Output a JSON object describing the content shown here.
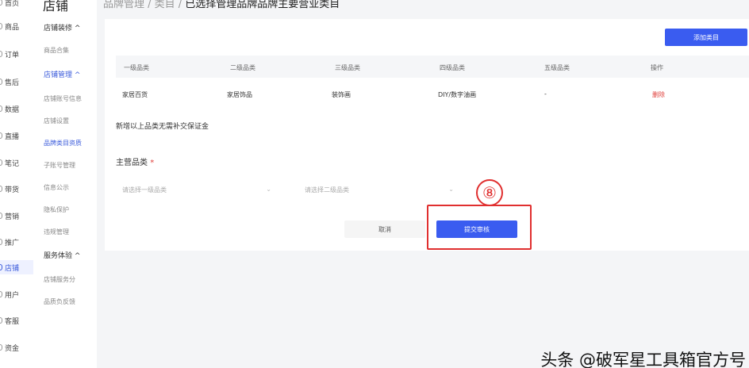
{
  "rail": {
    "items": [
      {
        "label": "首页"
      },
      {
        "label": "商品"
      },
      {
        "label": "订单"
      },
      {
        "label": "售后"
      },
      {
        "label": "数据"
      },
      {
        "label": "直播"
      },
      {
        "label": "笔记"
      },
      {
        "label": "带货"
      },
      {
        "label": "营销"
      },
      {
        "label": "推广"
      },
      {
        "label": "店铺"
      },
      {
        "label": "用户"
      },
      {
        "label": "客服"
      },
      {
        "label": "资金"
      }
    ]
  },
  "sidebar": {
    "title": "店铺",
    "groups": [
      {
        "label": "店铺装修 ^",
        "links": [
          "商品合集"
        ]
      },
      {
        "label": "店铺管理 ^",
        "links": [
          "店铺账号信息",
          "店铺设置",
          "品牌类目资质",
          "子账号管理",
          "信息公示",
          "隐私保护",
          "违规管理"
        ]
      },
      {
        "label": "服务体验 ^",
        "links": [
          "店铺服务分",
          "品质负反馈"
        ]
      }
    ]
  },
  "breadcrumb": {
    "prefix": "品牌管理 / 类目 / ",
    "current": "已选择管理品牌品牌主要营业类目"
  },
  "card": {
    "add_button": "添加类目",
    "table": {
      "headers": [
        "一级品类",
        "二级品类",
        "三级品类",
        "四级品类",
        "五级品类",
        "操作"
      ],
      "rows": [
        [
          "家居百货",
          "家居饰品",
          "装饰画",
          "DIY/数字油画",
          "-",
          "删除"
        ]
      ]
    },
    "note": "新增以上品类无需补交保证金",
    "main_category_label": "主营品类",
    "required_mark": "*",
    "select1_placeholder": "请选择一级品类",
    "select2_placeholder": "请选择二级品类",
    "chevron": "⌄",
    "cancel_button": "取消",
    "submit_button": "提交审核"
  },
  "annotation": {
    "step_number": "⑧",
    "highlight_color": "#e02f2f"
  },
  "watermark": "头条 @破军星工具箱官方号",
  "colors": {
    "accent": "#3a5cf0",
    "danger": "#e0413c"
  }
}
